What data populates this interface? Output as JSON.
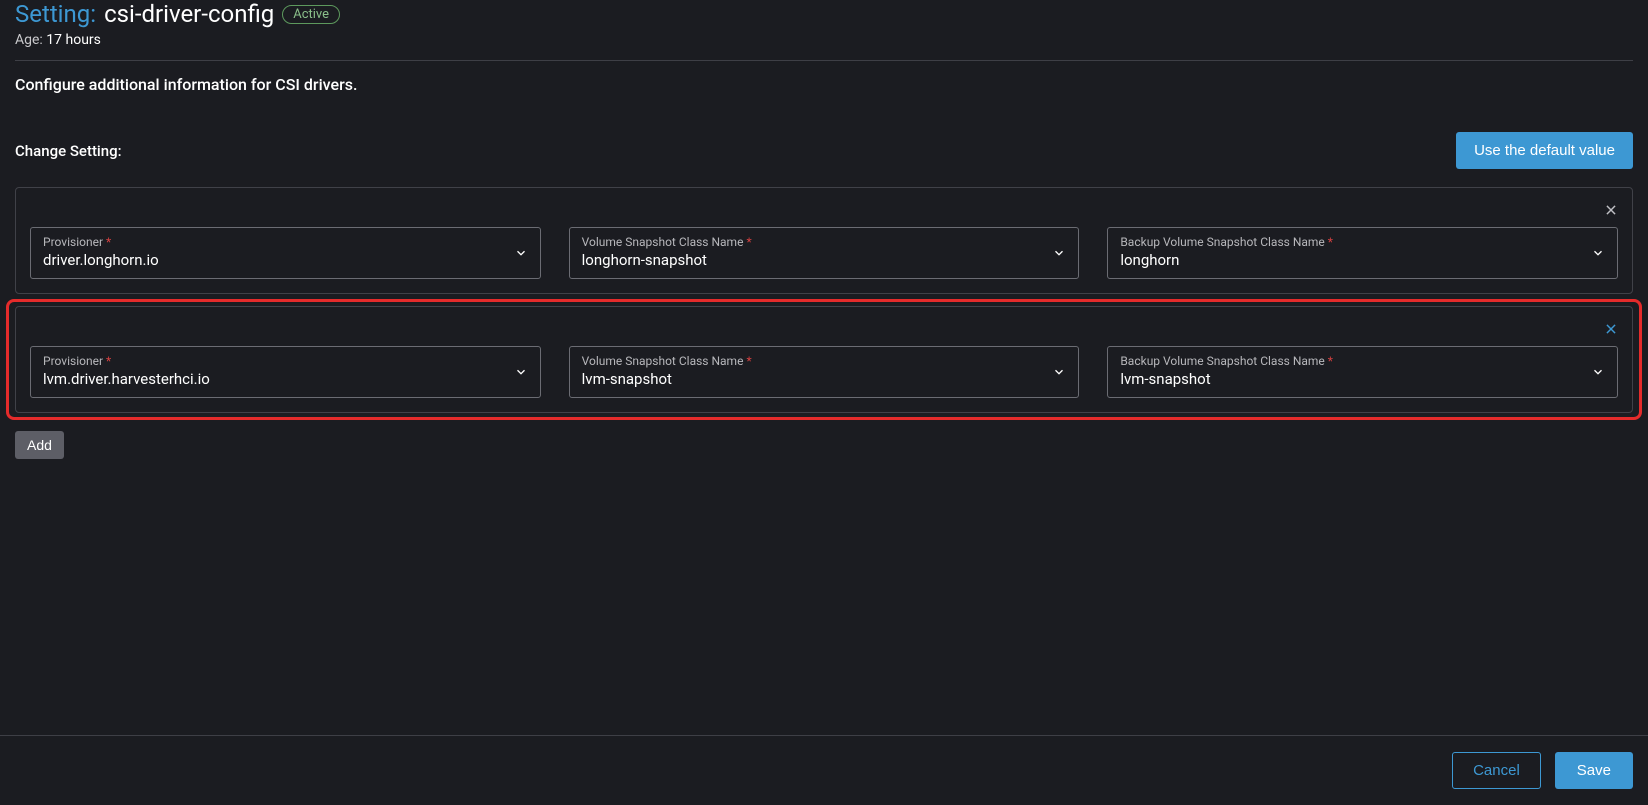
{
  "header": {
    "title_prefix": "Setting:",
    "title_name": "csi-driver-config",
    "status": "Active",
    "age_label": "Age:",
    "age_value": "17 hours"
  },
  "description": "Configure additional information for CSI drivers.",
  "change_label": "Change Setting:",
  "buttons": {
    "default_value": "Use the default value",
    "add": "Add",
    "cancel": "Cancel",
    "save": "Save"
  },
  "field_labels": {
    "provisioner": "Provisioner",
    "vol_snapshot": "Volume Snapshot Class Name",
    "backup_vol_snapshot": "Backup Volume Snapshot Class Name"
  },
  "rows": [
    {
      "provisioner": "driver.longhorn.io",
      "vol_snapshot": "longhorn-snapshot",
      "backup_vol_snapshot": "longhorn",
      "highlighted": false,
      "close_color": "gray"
    },
    {
      "provisioner": "lvm.driver.harvesterhci.io",
      "vol_snapshot": "lvm-snapshot",
      "backup_vol_snapshot": "lvm-snapshot",
      "highlighted": true,
      "close_color": "blue"
    }
  ]
}
